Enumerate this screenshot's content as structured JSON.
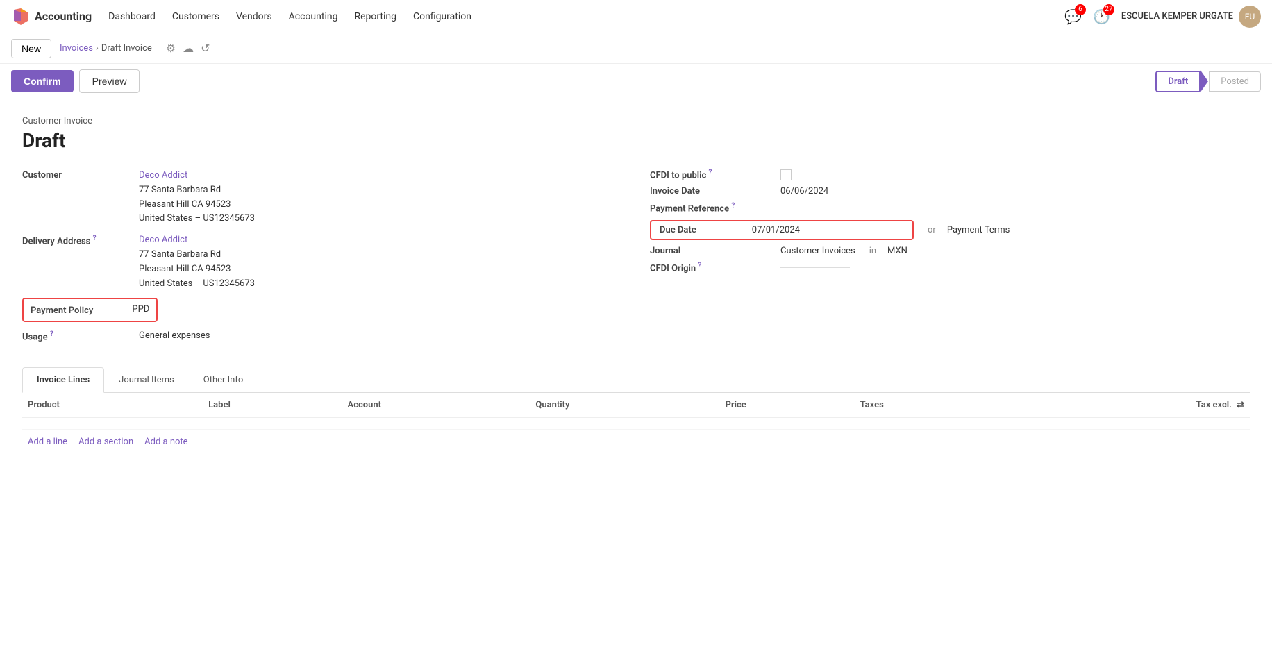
{
  "app": {
    "name": "Accounting",
    "logo_text": "✕"
  },
  "nav": {
    "items": [
      "Dashboard",
      "Customers",
      "Vendors",
      "Accounting",
      "Reporting",
      "Configuration"
    ],
    "notifications_count": "6",
    "clock_count": "27",
    "user_name": "ESCUELA KEMPER URGATE"
  },
  "breadcrumb": {
    "new_label": "New",
    "parent_link": "Invoices",
    "current": "Draft Invoice"
  },
  "actions": {
    "confirm_label": "Confirm",
    "preview_label": "Preview",
    "status_draft": "Draft",
    "status_posted": "Posted"
  },
  "invoice": {
    "type_label": "Customer Invoice",
    "title": "Draft",
    "customer_label": "Customer",
    "customer_name": "Deco Addict",
    "customer_address_1": "77 Santa Barbara Rd",
    "customer_address_2": "Pleasant Hill CA 94523",
    "customer_address_3": "United States – US12345673",
    "delivery_address_label": "Delivery Address",
    "delivery_name": "Deco Addict",
    "delivery_address_1": "77 Santa Barbara Rd",
    "delivery_address_2": "Pleasant Hill CA 94523",
    "delivery_address_3": "United States – US12345673",
    "payment_policy_label": "Payment Policy",
    "payment_policy_value": "PPD",
    "usage_label": "Usage",
    "usage_value": "General expenses",
    "cfdi_public_label": "CFDI to public",
    "invoice_date_label": "Invoice Date",
    "invoice_date_value": "06/06/2024",
    "payment_ref_label": "Payment Reference",
    "due_date_label": "Due Date",
    "due_date_value": "07/01/2024",
    "or_label": "or",
    "payment_terms_label": "Payment Terms",
    "journal_label": "Journal",
    "journal_value": "Customer Invoices",
    "in_label": "in",
    "currency_value": "MXN",
    "cfdi_origin_label": "CFDI Origin"
  },
  "tabs": {
    "items": [
      "Invoice Lines",
      "Journal Items",
      "Other Info"
    ],
    "active": "Invoice Lines"
  },
  "table": {
    "columns": [
      "Product",
      "Label",
      "Account",
      "Quantity",
      "Price",
      "Taxes",
      "Tax excl."
    ],
    "rows": []
  },
  "add_actions": {
    "add_line": "Add a line",
    "add_section": "Add a section",
    "add_note": "Add a note"
  }
}
